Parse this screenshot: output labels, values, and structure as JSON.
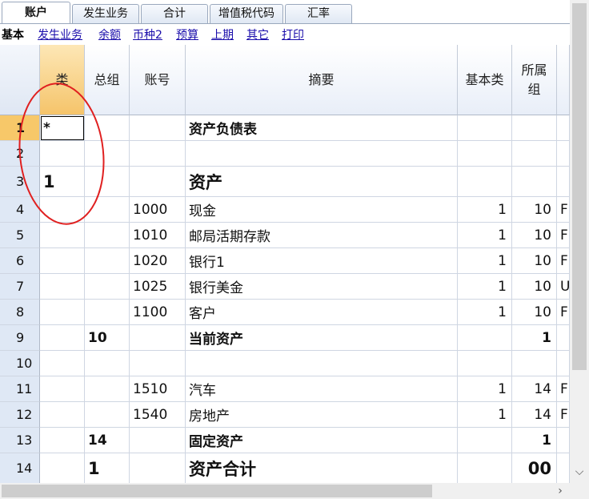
{
  "tabs": [
    {
      "label": "账户",
      "active": true
    },
    {
      "label": "发生业务",
      "active": false
    },
    {
      "label": "合计",
      "active": false
    },
    {
      "label": "增值税代码",
      "active": false
    },
    {
      "label": "汇率",
      "active": false
    }
  ],
  "subnav": {
    "current": "基本",
    "links": [
      "发生业务",
      "余额",
      "币种2",
      "预算",
      "上期",
      "其它",
      "打印"
    ]
  },
  "columns": [
    "类",
    "总组",
    "账号",
    "摘要",
    "基本类",
    "所属组"
  ],
  "rows": [
    {
      "n": "1",
      "cls": "*",
      "gr": "",
      "acc": "",
      "desc": "资产负债表",
      "bc": "",
      "grp": "",
      "cur": ""
    },
    {
      "n": "2",
      "cls": "",
      "gr": "",
      "acc": "",
      "desc": "",
      "bc": "",
      "grp": "",
      "cur": ""
    },
    {
      "n": "3",
      "cls": "1",
      "gr": "",
      "acc": "",
      "desc": "资产",
      "bc": "",
      "grp": "",
      "cur": ""
    },
    {
      "n": "4",
      "cls": "",
      "gr": "",
      "acc": "1000",
      "desc": "现金",
      "bc": "1",
      "grp": "10",
      "cur": "F"
    },
    {
      "n": "5",
      "cls": "",
      "gr": "",
      "acc": "1010",
      "desc": "邮局活期存款",
      "bc": "1",
      "grp": "10",
      "cur": "F"
    },
    {
      "n": "6",
      "cls": "",
      "gr": "",
      "acc": "1020",
      "desc": "银行1",
      "bc": "1",
      "grp": "10",
      "cur": "F"
    },
    {
      "n": "7",
      "cls": "",
      "gr": "",
      "acc": "1025",
      "desc": "银行美金",
      "bc": "1",
      "grp": "10",
      "cur": "U"
    },
    {
      "n": "8",
      "cls": "",
      "gr": "",
      "acc": "1100",
      "desc": "客户",
      "bc": "1",
      "grp": "10",
      "cur": "F"
    },
    {
      "n": "9",
      "cls": "",
      "gr": "10",
      "acc": "",
      "desc": "当前资产",
      "bc": "",
      "grp": "1",
      "cur": ""
    },
    {
      "n": "10",
      "cls": "",
      "gr": "",
      "acc": "",
      "desc": "",
      "bc": "",
      "grp": "",
      "cur": ""
    },
    {
      "n": "11",
      "cls": "",
      "gr": "",
      "acc": "1510",
      "desc": "汽车",
      "bc": "1",
      "grp": "14",
      "cur": "F"
    },
    {
      "n": "12",
      "cls": "",
      "gr": "",
      "acc": "1540",
      "desc": "房地产",
      "bc": "1",
      "grp": "14",
      "cur": "F"
    },
    {
      "n": "13",
      "cls": "",
      "gr": "14",
      "acc": "",
      "desc": "固定资产",
      "bc": "",
      "grp": "1",
      "cur": ""
    },
    {
      "n": "14",
      "cls": "",
      "gr": "1",
      "acc": "",
      "desc": "资产合计",
      "bc": "",
      "grp": "00",
      "cur": ""
    }
  ],
  "colors": {
    "selected_header": "#f5c46a",
    "row_header": "#dfe8f5",
    "annotation": "#e02020",
    "link": "#1a0dab"
  },
  "icons": {
    "scroll_down": "chevron-down-icon",
    "scroll_right": "chevron-right-icon"
  }
}
